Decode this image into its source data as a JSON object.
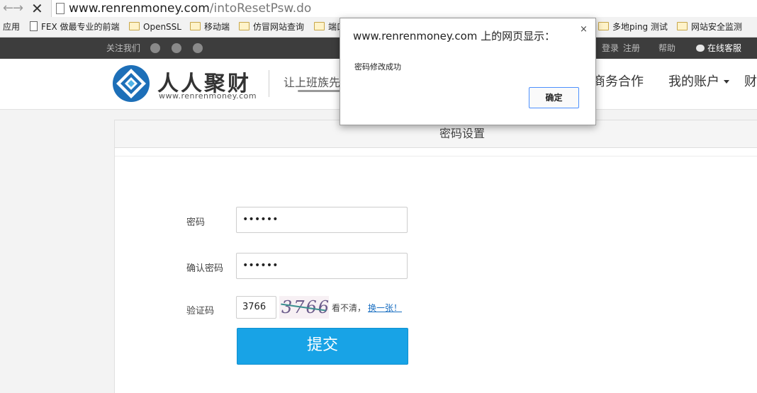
{
  "browser": {
    "url_host": "www.renrenmoney.com",
    "url_path": "/intoResetPsw.do",
    "bookmarks": [
      {
        "label": "应用",
        "icon": "apps-icon"
      },
      {
        "label": "FEX 做最专业的前端",
        "icon": "page-icon"
      },
      {
        "label": "OpenSSL",
        "icon": "folder-icon"
      },
      {
        "label": "移动端",
        "icon": "folder-icon"
      },
      {
        "label": "仿冒网站查询",
        "icon": "folder-icon"
      },
      {
        "label": "端口",
        "icon": "folder-icon"
      },
      {
        "label": "多地ping 测试",
        "icon": "folder-icon"
      },
      {
        "label": "网站安全监测",
        "icon": "folder-icon"
      }
    ]
  },
  "topbar": {
    "follow": "关注我们",
    "login": "登录",
    "register": "注册",
    "help": "帮助",
    "service": "在线客服"
  },
  "header": {
    "logo_title": "人人聚财",
    "logo_sub": "www.renrenmoney.com",
    "slogan": "让上班族先",
    "nav": [
      {
        "label": "商务合作"
      },
      {
        "label": "我的账户"
      },
      {
        "label": "财"
      }
    ]
  },
  "form": {
    "title": "密码设置",
    "password_label": "密码",
    "password_value": "••••••",
    "confirm_label": "确认密码",
    "confirm_value": "••••••",
    "captcha_label": "验证码",
    "captcha_value": "3766",
    "captcha_image_text": "3766",
    "hint": "看不清，",
    "refresh": "换一张！",
    "submit": "提交"
  },
  "dialog": {
    "title": "www.renrenmoney.com 上的网页显示：",
    "close": "×",
    "message": "密码修改成功",
    "ok": "确定"
  },
  "colors": {
    "submit_bg": "#18a3e6",
    "topbar_bg": "#3d3d3d",
    "logo_blue": "#1d6fb8"
  }
}
